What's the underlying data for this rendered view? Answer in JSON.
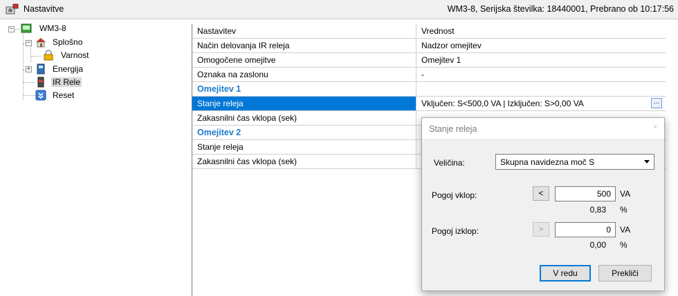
{
  "window": {
    "title": "Nastavitve",
    "device_info": "WM3-8, Serijska številka: 18440001, Prebrano ob 10:17:56"
  },
  "tree": {
    "root": {
      "label": "WM3-8",
      "icon": "device-icon"
    },
    "items": [
      {
        "label": "Splošno",
        "icon": "house-icon"
      },
      {
        "label": "Varnost",
        "icon": "lock-icon"
      },
      {
        "label": "Energija",
        "icon": "meter-icon"
      },
      {
        "label": "IR Rele",
        "icon": "relay-icon",
        "selected": true
      },
      {
        "label": "Reset",
        "icon": "reset-icon"
      }
    ],
    "expander_minus": "−",
    "expander_plus": "+"
  },
  "grid": {
    "header": {
      "name": "Nastavitev",
      "value": "Vrednost"
    },
    "rows": [
      {
        "name": "Način delovanja IR releja",
        "value": "Nadzor omejitev"
      },
      {
        "name": "Omogočene omejitve",
        "value": "Omejitev 1"
      },
      {
        "name": "Oznaka na zaslonu",
        "value": "-"
      },
      {
        "name": "Omejitev 1",
        "value": ""
      },
      {
        "name": "Stanje releja",
        "value": "Vključen: S<500,0 VA | Izključen: S>0,00 VA"
      },
      {
        "name": "Zakasnilni čas vklopa (sek)",
        "value": ""
      },
      {
        "name": "Omejitev 2",
        "value": ""
      },
      {
        "name": "Stanje releja",
        "value": ""
      },
      {
        "name": "Zakasnilni čas vklopa (sek)",
        "value": ""
      }
    ],
    "ellipsis": "..."
  },
  "dialog": {
    "title": "Stanje releja",
    "close": "×",
    "quantity_label": "Veličina:",
    "quantity_value": "Skupna navidezna moč S",
    "on_label": "Pogoj vklop:",
    "on_op": "<",
    "on_value": "500",
    "on_unit": "VA",
    "on_pct": "0,83",
    "off_label": "Pogoj izklop:",
    "off_op": ">",
    "off_value": "0",
    "off_unit": "VA",
    "off_pct": "0,00",
    "pct_unit": "%",
    "ok": "V redu",
    "cancel": "Prekliči"
  },
  "colors": {
    "selection": "#0078d7",
    "section_header": "#1e7bd0"
  }
}
